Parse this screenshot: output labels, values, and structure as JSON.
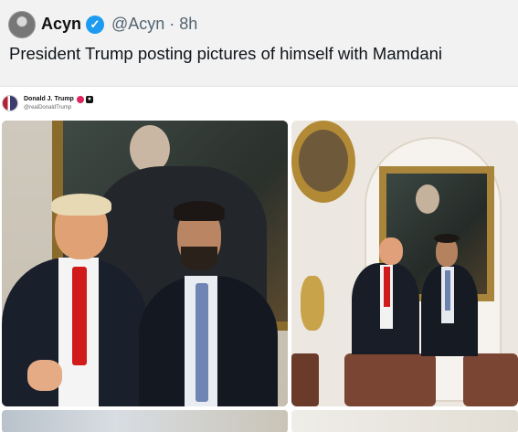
{
  "tweet": {
    "author_name": "Acyn",
    "verified_icon": "verified-badge-icon",
    "handle_time": "@Acyn · 8h",
    "text": "President Trump posting pictures of himself with Mamdani"
  },
  "embedded_post": {
    "author_name": "Donald J. Trump",
    "handle": "@realDonaldTrump",
    "photos": [
      {
        "description_icon": "photo-trump-mamdani-closeup"
      },
      {
        "description_icon": "photo-trump-mamdani-oval-office"
      }
    ]
  }
}
